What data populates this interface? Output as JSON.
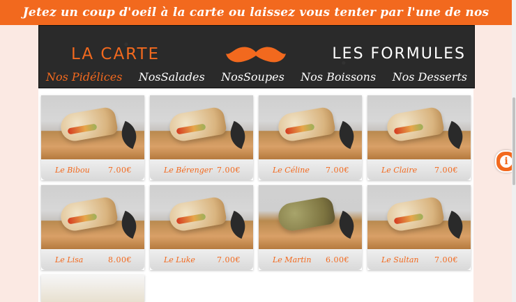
{
  "banner": {
    "text": "Jetez un coup d'oeil à la carte ou laissez vous tenter par l'une de nos formules"
  },
  "header": {
    "la_carte": "LA CARTE",
    "les_formules": "LES FORMULES",
    "logo_icon": "mustache-icon",
    "categories": [
      {
        "label": "Nos Pidélices",
        "active": true
      },
      {
        "label": "NosSalades",
        "active": false
      },
      {
        "label": "NosSoupes",
        "active": false
      },
      {
        "label": "Nos Boissons",
        "active": false
      },
      {
        "label": "Nos Desserts",
        "active": false
      }
    ]
  },
  "products": [
    {
      "name": "Le Bibou",
      "price": "7.00€"
    },
    {
      "name": "Le Bérenger",
      "price": "7.00€"
    },
    {
      "name": "Le Céline",
      "price": "7.00€"
    },
    {
      "name": "Le Claire",
      "price": "7.00€"
    },
    {
      "name": "Le Lisa",
      "price": "8.00€"
    },
    {
      "name": "Le Luke",
      "price": "7.00€"
    },
    {
      "name": "Le Martin",
      "price": "6.00€"
    },
    {
      "name": "Le Sultan",
      "price": "7.00€"
    }
  ],
  "colors": {
    "accent": "#f2691e",
    "board": "#2a2a2a",
    "background": "#fbe9e3"
  },
  "info_icon": "info-icon"
}
